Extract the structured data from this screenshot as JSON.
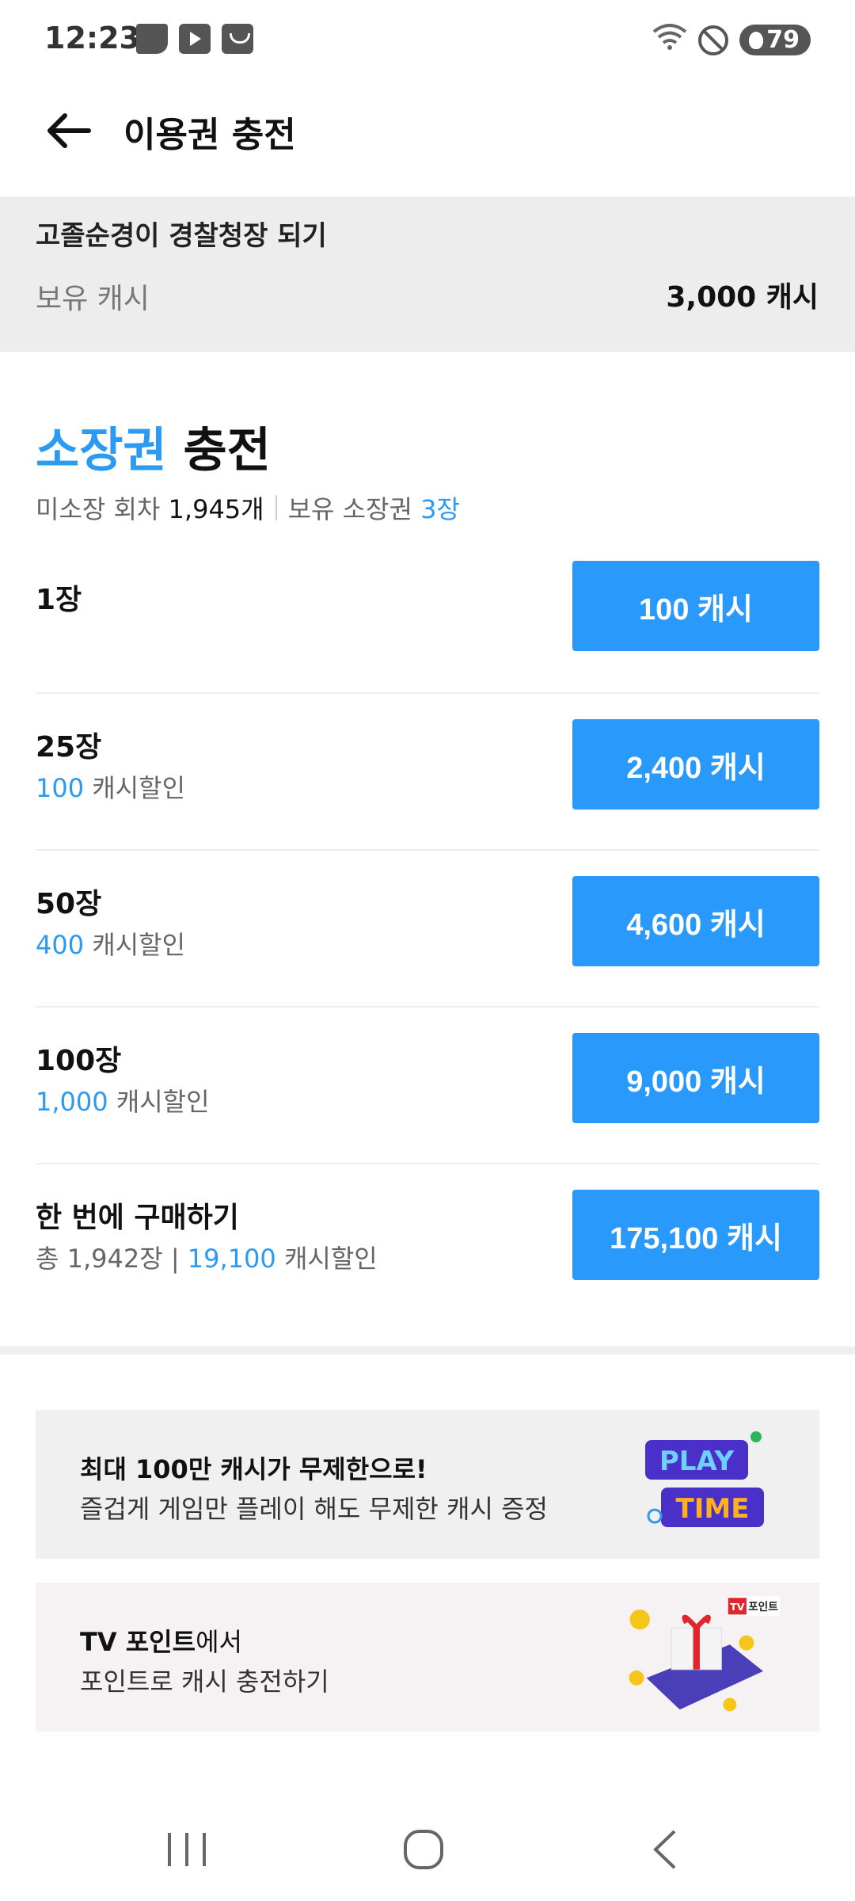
{
  "status_bar": {
    "time": "12:23",
    "battery": "79"
  },
  "header": {
    "title": "이용권 충전"
  },
  "account": {
    "name": "고졸순경이 경찰청장 되기",
    "cash_label": "보유 캐시",
    "cash_value": "3,000 캐시"
  },
  "section": {
    "title_highlight": "소장권",
    "title_rest": " 충전",
    "unowned_label": "미소장 회차",
    "unowned_value": "1,945개",
    "owned_label": "보유 소장권",
    "owned_value": "3장"
  },
  "options": [
    {
      "title": "1장",
      "price": "100 캐시"
    },
    {
      "title": "25장",
      "discount_value": "100",
      "discount_suffix": " 캐시할인",
      "price": "2,400 캐시"
    },
    {
      "title": "50장",
      "discount_value": "400",
      "discount_suffix": " 캐시할인",
      "price": "4,600 캐시"
    },
    {
      "title": "100장",
      "discount_value": "1,000",
      "discount_suffix": " 캐시할인",
      "price": "9,000 캐시"
    },
    {
      "title": "한 번에 구매하기",
      "total_prefix": "총 1,942장 | ",
      "discount_value": "19,100",
      "discount_suffix": " 캐시할인",
      "price": "175,100 캐시"
    }
  ],
  "banners": [
    {
      "line1": "최대 100만 캐시가 무제한으로!",
      "line2": "즐겁게 게임만 플레이 해도 무제한 캐시 증정",
      "image_text_1": "PLAY",
      "image_text_2": "TIME"
    },
    {
      "line1_bold": "TV 포인트",
      "line1_rest": "에서",
      "line2": "포인트로 캐시 충전하기",
      "badge_icon": "TV",
      "badge_text": "포인트"
    }
  ],
  "colors": {
    "accent": "#2999fb",
    "account_bg": "#ededed"
  }
}
